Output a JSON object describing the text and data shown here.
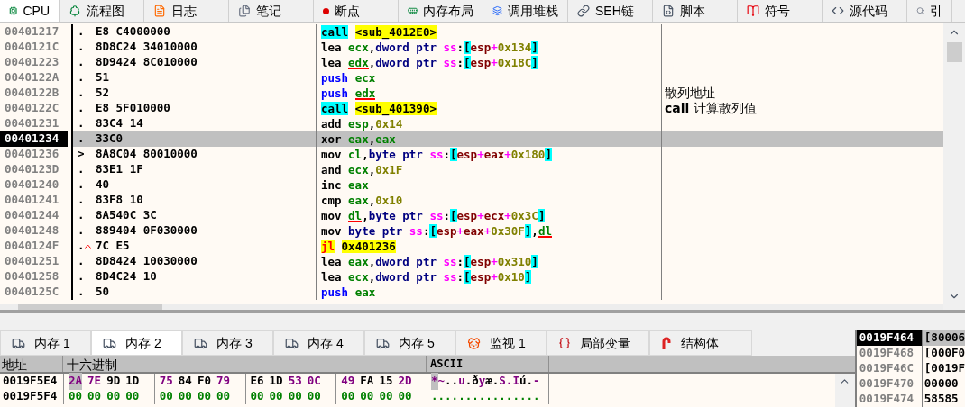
{
  "top_tabs": [
    {
      "label": "CPU",
      "selected": true
    },
    {
      "label": "流程图",
      "selected": false
    },
    {
      "label": "日志",
      "selected": false
    },
    {
      "label": "笔记",
      "selected": false
    },
    {
      "label": "断点",
      "selected": false
    },
    {
      "label": "内存布局",
      "selected": false
    },
    {
      "label": "调用堆栈",
      "selected": false
    },
    {
      "label": "SEH链",
      "selected": false
    },
    {
      "label": "脚本",
      "selected": false
    },
    {
      "label": "符号",
      "selected": false
    },
    {
      "label": "源代码",
      "selected": false
    },
    {
      "label": "引",
      "selected": false
    }
  ],
  "disassembly": {
    "rows": [
      {
        "address": "00401217",
        "selected": false,
        "marker": ".",
        "jump_up": false,
        "bytes": "E8 C4000000",
        "tokens": [
          {
            "text": "call",
            "kind": "call_op"
          },
          {
            "text": "<sub_4012E0>",
            "kind": "target"
          }
        ]
      },
      {
        "address": "0040121C",
        "selected": false,
        "marker": ".",
        "jump_up": false,
        "bytes": "8D8C24 34010000",
        "tokens": [
          {
            "text": "lea",
            "kind": "op"
          },
          {
            "text": "ecx",
            "kind": "reg"
          },
          {
            "text": ",",
            "kind": "punct"
          },
          {
            "text": "dword ptr",
            "kind": "size"
          },
          {
            "text": "ss",
            "kind": "seg"
          },
          {
            "text": ":",
            "kind": "punct"
          },
          {
            "text": "[",
            "kind": "bracket"
          },
          {
            "text": "esp",
            "kind": "base"
          },
          {
            "text": "+",
            "kind": "plus"
          },
          {
            "text": "0x134",
            "kind": "num"
          },
          {
            "text": "]",
            "kind": "bracket"
          }
        ]
      },
      {
        "address": "00401223",
        "selected": false,
        "marker": ".",
        "jump_up": false,
        "bytes": "8D9424 8C010000",
        "tokens": [
          {
            "text": "lea",
            "kind": "op"
          },
          {
            "text": "edx",
            "kind": "reg_marked"
          },
          {
            "text": ",",
            "kind": "punct"
          },
          {
            "text": "dword ptr",
            "kind": "size"
          },
          {
            "text": "ss",
            "kind": "seg"
          },
          {
            "text": ":",
            "kind": "punct"
          },
          {
            "text": "[",
            "kind": "bracket"
          },
          {
            "text": "esp",
            "kind": "base"
          },
          {
            "text": "+",
            "kind": "plus"
          },
          {
            "text": "0x18C",
            "kind": "num"
          },
          {
            "text": "]",
            "kind": "bracket"
          }
        ]
      },
      {
        "address": "0040122A",
        "selected": false,
        "marker": ".",
        "jump_up": false,
        "bytes": "51",
        "tokens": [
          {
            "text": "push",
            "kind": "push_op"
          },
          {
            "text": "ecx",
            "kind": "reg"
          }
        ]
      },
      {
        "address": "0040122B",
        "selected": false,
        "marker": ".",
        "jump_up": false,
        "bytes": "52",
        "tokens": [
          {
            "text": "push",
            "kind": "push_op"
          },
          {
            "text": "edx",
            "kind": "reg_marked"
          }
        ],
        "comment": "散列地址"
      },
      {
        "address": "0040122C",
        "selected": false,
        "marker": ".",
        "jump_up": false,
        "bytes": "E8 5F010000",
        "tokens": [
          {
            "text": "call",
            "kind": "call_op"
          },
          {
            "text": "<sub_401390>",
            "kind": "target"
          }
        ],
        "comment": "**call** 计算散列值"
      },
      {
        "address": "00401231",
        "selected": false,
        "marker": ".",
        "jump_up": false,
        "bytes": "83C4 14",
        "tokens": [
          {
            "text": "add",
            "kind": "op"
          },
          {
            "text": "esp",
            "kind": "reg"
          },
          {
            "text": ",",
            "kind": "punct"
          },
          {
            "text": "0x14",
            "kind": "num"
          }
        ]
      },
      {
        "address": "00401234",
        "selected": true,
        "marker": ".",
        "jump_up": false,
        "bytes": "33C0",
        "tokens": [
          {
            "text": "xor",
            "kind": "op"
          },
          {
            "text": "eax",
            "kind": "reg"
          },
          {
            "text": ",",
            "kind": "punct"
          },
          {
            "text": "eax",
            "kind": "reg"
          }
        ]
      },
      {
        "address": "00401236",
        "selected": false,
        "marker": ">",
        "jump_up": false,
        "bytes": "8A8C04 80010000",
        "tokens": [
          {
            "text": "mov",
            "kind": "op"
          },
          {
            "text": "cl",
            "kind": "reg"
          },
          {
            "text": ",",
            "kind": "punct"
          },
          {
            "text": "byte ptr",
            "kind": "size"
          },
          {
            "text": "ss",
            "kind": "seg"
          },
          {
            "text": ":",
            "kind": "punct"
          },
          {
            "text": "[",
            "kind": "bracket"
          },
          {
            "text": "esp",
            "kind": "base"
          },
          {
            "text": "+",
            "kind": "plus"
          },
          {
            "text": "eax",
            "kind": "base"
          },
          {
            "text": "+",
            "kind": "plus"
          },
          {
            "text": "0x180",
            "kind": "num"
          },
          {
            "text": "]",
            "kind": "bracket"
          }
        ]
      },
      {
        "address": "0040123D",
        "selected": false,
        "marker": ".",
        "jump_up": false,
        "bytes": "83E1 1F",
        "tokens": [
          {
            "text": "and",
            "kind": "op"
          },
          {
            "text": "ecx",
            "kind": "reg"
          },
          {
            "text": ",",
            "kind": "punct"
          },
          {
            "text": "0x1F",
            "kind": "num"
          }
        ]
      },
      {
        "address": "00401240",
        "selected": false,
        "marker": ".",
        "jump_up": false,
        "bytes": "40",
        "tokens": [
          {
            "text": "inc",
            "kind": "op"
          },
          {
            "text": "eax",
            "kind": "reg"
          }
        ]
      },
      {
        "address": "00401241",
        "selected": false,
        "marker": ".",
        "jump_up": false,
        "bytes": "83F8 10",
        "tokens": [
          {
            "text": "cmp",
            "kind": "op"
          },
          {
            "text": "eax",
            "kind": "reg"
          },
          {
            "text": ",",
            "kind": "punct"
          },
          {
            "text": "0x10",
            "kind": "num"
          }
        ]
      },
      {
        "address": "00401244",
        "selected": false,
        "marker": ".",
        "jump_up": false,
        "bytes": "8A540C 3C",
        "tokens": [
          {
            "text": "mov",
            "kind": "op"
          },
          {
            "text": "dl",
            "kind": "reg_marked"
          },
          {
            "text": ",",
            "kind": "punct"
          },
          {
            "text": "byte ptr",
            "kind": "size"
          },
          {
            "text": "ss",
            "kind": "seg"
          },
          {
            "text": ":",
            "kind": "punct"
          },
          {
            "text": "[",
            "kind": "bracket"
          },
          {
            "text": "esp",
            "kind": "base"
          },
          {
            "text": "+",
            "kind": "plus"
          },
          {
            "text": "ecx",
            "kind": "base"
          },
          {
            "text": "+",
            "kind": "plus"
          },
          {
            "text": "0x3C",
            "kind": "num"
          },
          {
            "text": "]",
            "kind": "bracket"
          }
        ]
      },
      {
        "address": "00401248",
        "selected": false,
        "marker": ".",
        "jump_up": false,
        "bytes": "889404 0F030000",
        "tokens": [
          {
            "text": "mov",
            "kind": "op"
          },
          {
            "text": "byte ptr",
            "kind": "size"
          },
          {
            "text": "ss",
            "kind": "seg"
          },
          {
            "text": ":",
            "kind": "punct"
          },
          {
            "text": "[",
            "kind": "bracket"
          },
          {
            "text": "esp",
            "kind": "base"
          },
          {
            "text": "+",
            "kind": "plus"
          },
          {
            "text": "eax",
            "kind": "base"
          },
          {
            "text": "+",
            "kind": "plus"
          },
          {
            "text": "0x30F",
            "kind": "num"
          },
          {
            "text": "]",
            "kind": "bracket"
          },
          {
            "text": ",",
            "kind": "punct"
          },
          {
            "text": "dl",
            "kind": "reg_marked"
          }
        ]
      },
      {
        "address": "0040124F",
        "selected": false,
        "marker": ".",
        "jump_up": true,
        "bytes": "7C E5",
        "tokens": [
          {
            "text": "jl",
            "kind": "jump_op"
          },
          {
            "text": "0x401236",
            "kind": "target"
          }
        ]
      },
      {
        "address": "00401251",
        "selected": false,
        "marker": ".",
        "jump_up": false,
        "bytes": "8D8424 10030000",
        "tokens": [
          {
            "text": "lea",
            "kind": "op"
          },
          {
            "text": "eax",
            "kind": "reg"
          },
          {
            "text": ",",
            "kind": "punct"
          },
          {
            "text": "dword ptr",
            "kind": "size"
          },
          {
            "text": "ss",
            "kind": "seg"
          },
          {
            "text": ":",
            "kind": "punct"
          },
          {
            "text": "[",
            "kind": "bracket"
          },
          {
            "text": "esp",
            "kind": "base"
          },
          {
            "text": "+",
            "kind": "plus"
          },
          {
            "text": "0x310",
            "kind": "num"
          },
          {
            "text": "]",
            "kind": "bracket"
          }
        ]
      },
      {
        "address": "00401258",
        "selected": false,
        "marker": ".",
        "jump_up": false,
        "bytes": "8D4C24 10",
        "tokens": [
          {
            "text": "lea",
            "kind": "op"
          },
          {
            "text": "ecx",
            "kind": "reg"
          },
          {
            "text": ",",
            "kind": "punct"
          },
          {
            "text": "dword ptr",
            "kind": "size"
          },
          {
            "text": "ss",
            "kind": "seg"
          },
          {
            "text": ":",
            "kind": "punct"
          },
          {
            "text": "[",
            "kind": "bracket"
          },
          {
            "text": "esp",
            "kind": "base"
          },
          {
            "text": "+",
            "kind": "plus"
          },
          {
            "text": "0x10",
            "kind": "num"
          },
          {
            "text": "]",
            "kind": "bracket"
          }
        ]
      },
      {
        "address": "0040125C",
        "selected": false,
        "marker": ".",
        "jump_up": false,
        "bytes": "50",
        "tokens": [
          {
            "text": "push",
            "kind": "push_op"
          },
          {
            "text": "eax",
            "kind": "reg"
          }
        ]
      }
    ]
  },
  "memory_tabs": [
    {
      "label": "内存 1",
      "kind": "memory",
      "selected": false
    },
    {
      "label": "内存 2",
      "kind": "memory",
      "selected": true
    },
    {
      "label": "内存 3",
      "kind": "memory",
      "selected": false
    },
    {
      "label": "内存 4",
      "kind": "memory",
      "selected": false
    },
    {
      "label": "内存 5",
      "kind": "memory",
      "selected": false
    },
    {
      "label": "监视 1",
      "kind": "watch",
      "selected": false
    },
    {
      "label": "局部变量",
      "kind": "locals",
      "selected": false
    },
    {
      "label": "结构体",
      "kind": "struct",
      "selected": false
    }
  ],
  "hex_dump": {
    "columns": [
      "地址",
      "十六进制",
      "ASCII"
    ],
    "rows": [
      {
        "address": "0019F5E4",
        "bytes": [
          {
            "text": "2A",
            "kind": "printable",
            "selected": true
          },
          {
            "text": "7E",
            "kind": "printable",
            "selected": false
          },
          {
            "text": "9D",
            "kind": "other",
            "selected": false
          },
          {
            "text": "1D",
            "kind": "other",
            "selected": false
          },
          {
            "text": "75",
            "kind": "printable",
            "selected": false
          },
          {
            "text": "84",
            "kind": "other",
            "selected": false
          },
          {
            "text": "F0",
            "kind": "other",
            "selected": false
          },
          {
            "text": "79",
            "kind": "printable",
            "selected": false
          },
          {
            "text": "E6",
            "kind": "other",
            "selected": false
          },
          {
            "text": "1D",
            "kind": "other",
            "selected": false
          },
          {
            "text": "53",
            "kind": "printable",
            "selected": false
          },
          {
            "text": "0C",
            "kind": "printable",
            "selected": false
          },
          {
            "text": "49",
            "kind": "printable",
            "selected": false
          },
          {
            "text": "FA",
            "kind": "other",
            "selected": false
          },
          {
            "text": "15",
            "kind": "other",
            "selected": false
          },
          {
            "text": "2D",
            "kind": "printable",
            "selected": false
          }
        ],
        "ascii": "*~..u.ðyæ.S.Iú.-"
      },
      {
        "address": "0019F5F4",
        "bytes": [
          {
            "text": "00",
            "kind": "zero",
            "selected": false
          },
          {
            "text": "00",
            "kind": "zero",
            "selected": false
          },
          {
            "text": "00",
            "kind": "zero",
            "selected": false
          },
          {
            "text": "00",
            "kind": "zero",
            "selected": false
          },
          {
            "text": "00",
            "kind": "zero",
            "selected": false
          },
          {
            "text": "00",
            "kind": "zero",
            "selected": false
          },
          {
            "text": "00",
            "kind": "zero",
            "selected": false
          },
          {
            "text": "00",
            "kind": "zero",
            "selected": false
          },
          {
            "text": "00",
            "kind": "zero",
            "selected": false
          },
          {
            "text": "00",
            "kind": "zero",
            "selected": false
          },
          {
            "text": "00",
            "kind": "zero",
            "selected": false
          },
          {
            "text": "00",
            "kind": "zero",
            "selected": false
          },
          {
            "text": "00",
            "kind": "zero",
            "selected": false
          },
          {
            "text": "00",
            "kind": "zero",
            "selected": false
          },
          {
            "text": "00",
            "kind": "zero",
            "selected": false
          },
          {
            "text": "00",
            "kind": "zero",
            "selected": false
          }
        ],
        "ascii": "................"
      }
    ]
  },
  "stack": {
    "rows": [
      {
        "address": "0019F464",
        "value": "[80006",
        "selected": true
      },
      {
        "address": "0019F468",
        "value": "[000F0",
        "selected": false
      },
      {
        "address": "0019F46C",
        "value": "[0019F",
        "selected": false
      },
      {
        "address": "0019F470",
        "value": "00000",
        "selected": false
      },
      {
        "address": "0019F474",
        "value": "58585",
        "selected": false
      }
    ]
  }
}
